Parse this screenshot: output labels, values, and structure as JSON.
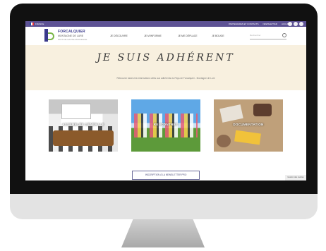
{
  "topbar": {
    "country_text": "FRANCE",
    "links": [
      "PARTENAIRES ET CONTACTS",
      "NEWSLETTER",
      "ACCUEIL"
    ]
  },
  "brand": {
    "name": "FORCALQUIER",
    "sub1": "MONTAGNE DE LURE",
    "sub2": "PAYS DE HAUTE-PROVENCE"
  },
  "nav": [
    "JE DÉCOUVRE",
    "JE M'INFORME",
    "JE ME DÉPLACE",
    "JE BOUGE"
  ],
  "search": {
    "placeholder": "Rechercher"
  },
  "hero": {
    "title": "JE SUIS ADHÉRENT",
    "subtitle": "Retrouvez toutes les informations utiles aux adhérents du Pays de Forcalquier - Montagne de Lure"
  },
  "cards": [
    {
      "label": "ASSEMBLÉE GÉNÉRALE"
    },
    {
      "label": "RENCONTRES"
    },
    {
      "label": "DOCUMENTATION"
    }
  ],
  "button_label": "INSCRIPTION À LA NEWSLETTER PRO",
  "cookie_label": "Gestion des cookies",
  "colors": {
    "topbar": "#5d5294",
    "brand": "#3a3a8c",
    "accent": "#7ab648",
    "hero_bg": "#f8f0df"
  }
}
